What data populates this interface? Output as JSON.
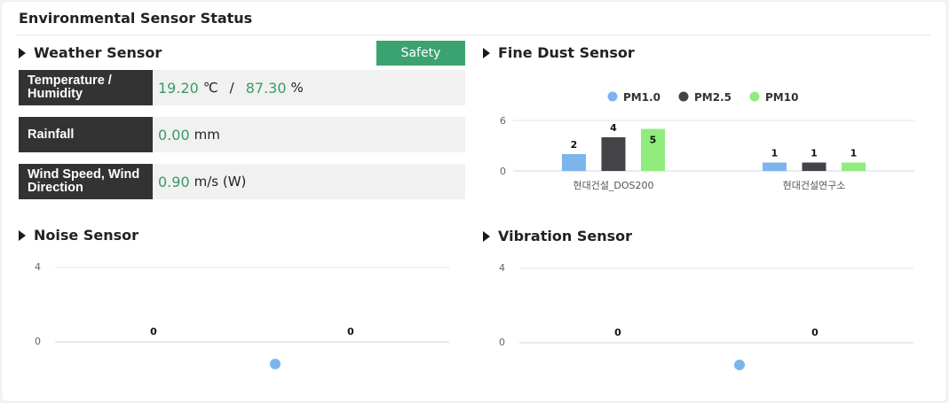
{
  "title": "Environmental Sensor Status",
  "weather": {
    "heading": "Weather Sensor",
    "status": "Safety",
    "temp_label": "Temperature / Humidity",
    "temp_value": "19.20",
    "temp_unit": "℃",
    "sep": "/",
    "humidity_value": "87.30",
    "humidity_unit": "%",
    "rain_label": "Rainfall",
    "rain_value": "0.00",
    "rain_unit": "mm",
    "wind_label": "Wind Speed, Wind Direction",
    "wind_value": "0.90",
    "wind_unit": "m/s (W)"
  },
  "dust": {
    "heading": "Fine Dust Sensor",
    "chart_data": {
      "type": "bar",
      "categories": [
        "현대건설_DOS200",
        "현대건설연구소"
      ],
      "series": [
        {
          "name": "PM1.0",
          "values": [
            2,
            1
          ],
          "color": "#7cb5ec"
        },
        {
          "name": "PM2.5",
          "values": [
            4,
            1
          ],
          "color": "#434348"
        },
        {
          "name": "PM10",
          "values": [
            5,
            1
          ],
          "color": "#90ed7d"
        }
      ],
      "y_ticks": [
        0,
        6
      ],
      "ylim": [
        0,
        6
      ],
      "legend": "top-center",
      "grid": true
    }
  },
  "noise": {
    "heading": "Noise Sensor",
    "chart_data": {
      "type": "line",
      "y_ticks": [
        0,
        4
      ],
      "ylim": [
        0,
        4
      ],
      "values": [
        0,
        0
      ],
      "color": "#7cb5ec"
    }
  },
  "vibration": {
    "heading": "Vibration Sensor",
    "chart_data": {
      "type": "line",
      "y_ticks": [
        0,
        4
      ],
      "ylim": [
        0,
        4
      ],
      "values": [
        0,
        0
      ],
      "color": "#7cb5ec"
    }
  }
}
